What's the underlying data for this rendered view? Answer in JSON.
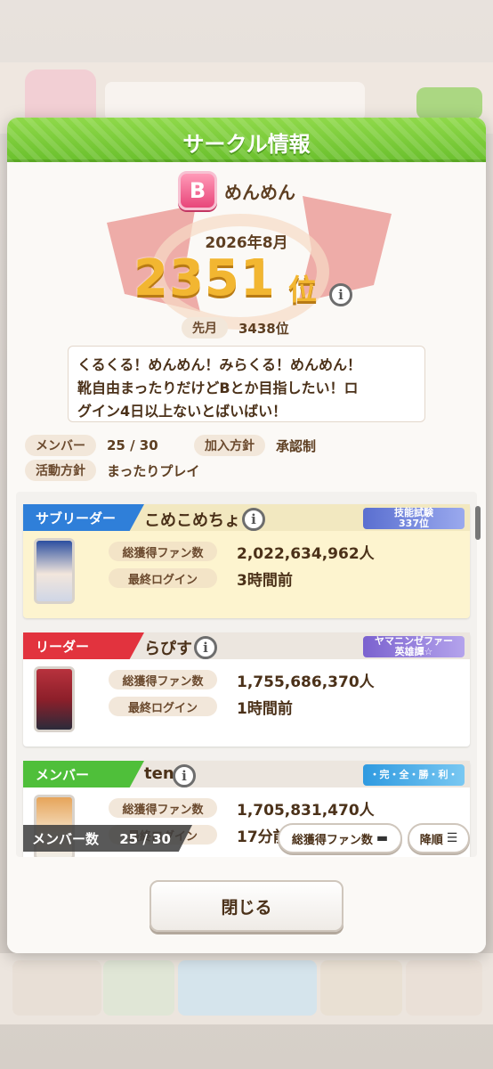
{
  "dialog": {
    "title": "サークル情報"
  },
  "circle": {
    "rank_letter": "B",
    "name": "めんめん",
    "period": "2026年8月",
    "rank_number": "2351",
    "rank_unit": "位",
    "last_month_label": "先月",
    "last_month_value": "3438位",
    "intro_lines": [
      "くるくる！めんめん！みらくる！めんめん！",
      "靴自由まったりだけどBとか目指したい！ロ",
      "グイン4日以上ないとばいばい！"
    ]
  },
  "stats": {
    "members_label": "メンバー",
    "members_value": "25 / 30",
    "join_label": "加入方針",
    "join_value": "承認制",
    "activity_label": "活動方針",
    "activity_value": "まったりプレイ"
  },
  "members": [
    {
      "role": "サブリーダー",
      "role_color": "#2f7fd9",
      "name": "こめこめちょ",
      "badge": "技能試験\n337位",
      "badge_color": "#6d7fd6",
      "fans_label": "総獲得ファン数",
      "fans_value": "2,022,634,962人",
      "login_label": "最終ログイン",
      "login_value": "3時間前"
    },
    {
      "role": "リーダー",
      "role_color": "#e2333e",
      "name": "らぴす",
      "badge": "ヤマニンゼファー\n英雄譚☆",
      "badge_color": "#8e78d6",
      "fans_label": "総獲得ファン数",
      "fans_value": "1,755,686,370人",
      "login_label": "最終ログイン",
      "login_value": "1時間前"
    },
    {
      "role": "メンバー",
      "role_color": "#4fbf3a",
      "name": "ten",
      "badge": "・完・全・勝・利・",
      "badge_color": "#3da6e6",
      "fans_label": "総獲得ファン数",
      "fans_value": "1,705,831,470人",
      "login_label": "最終ログイン",
      "login_value": "17分前"
    }
  ],
  "list_controls": {
    "count_label": "メンバー数",
    "count_value": "25 / 30",
    "sort_key_label": "総獲得ファン数",
    "order_label": "降順"
  },
  "close_label": "閉じる"
}
